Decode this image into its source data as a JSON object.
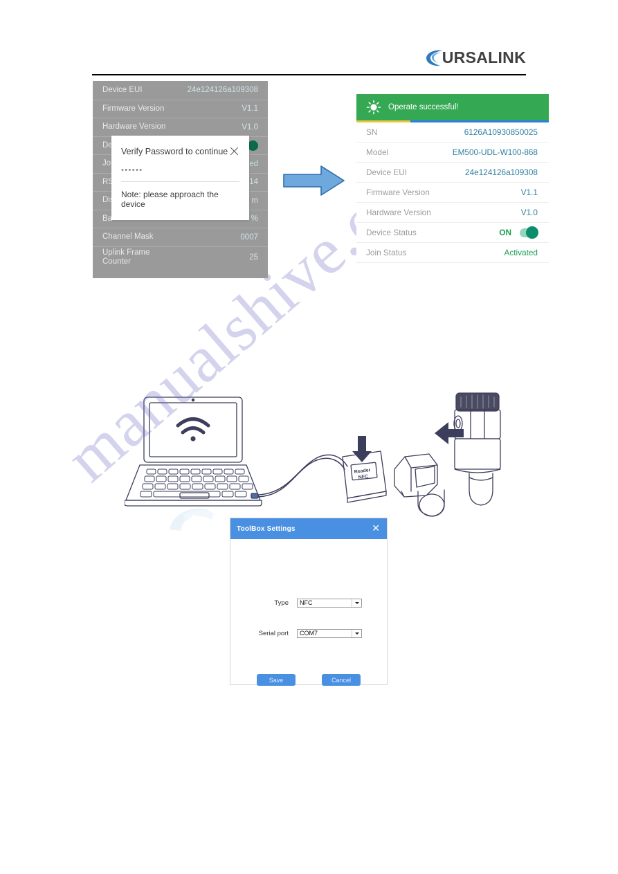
{
  "brand": {
    "name": "URSALINK",
    "mark_icon": "ursalink-swoosh-icon"
  },
  "phone_panel": {
    "rows": [
      {
        "key": "Device EUI",
        "value": "24e124126a109308"
      },
      {
        "key": "Firmware Version",
        "value": "V1.1"
      },
      {
        "key": "Hardware Version",
        "value": "V1.0"
      },
      {
        "key": "De",
        "value": ""
      },
      {
        "key": "Jo",
        "value": "ed"
      },
      {
        "key": "RS",
        "value": "14"
      },
      {
        "key": "Dis",
        "value": " m"
      },
      {
        "key": "Ba",
        "value": " %"
      },
      {
        "key": "Channel Mask",
        "value": "0007"
      },
      {
        "key": "Uplink Frame\nCounter",
        "value": "25"
      }
    ]
  },
  "verify_modal": {
    "title": "Verify Password to continue",
    "close_icon": "close-icon",
    "password_value": "••••••",
    "note": "Note: please approach the device"
  },
  "flow_arrow": {
    "icon": "right-arrow-icon",
    "color": "#6fa8dc"
  },
  "info_panel": {
    "success_banner": {
      "icon": "sun-burst-icon",
      "text": "Operate successful!",
      "color": "#34a853"
    },
    "progress": {
      "segment1_color": "#e8c840",
      "segment2_color": "#2f7de1"
    },
    "rows": [
      {
        "key": "SN",
        "value": "6126A10930850025",
        "style": "value"
      },
      {
        "key": "Model",
        "value": "EM500-UDL-W100-868",
        "style": "value"
      },
      {
        "key": "Device EUI",
        "value": "24e124126a109308",
        "style": "value"
      },
      {
        "key": "Firmware Version",
        "value": "V1.1",
        "style": "value"
      },
      {
        "key": "Hardware Version",
        "value": "V1.0",
        "style": "value"
      },
      {
        "key": "Device Status",
        "value": "ON",
        "style": "status-toggle"
      },
      {
        "key": "Join Status",
        "value": "Activated",
        "style": "green"
      }
    ]
  },
  "illustration": {
    "laptop_icon": "laptop-icon",
    "wifi_icon": "wifi-icon",
    "reader_label_line1": "Reader",
    "reader_label_line2": "NFC",
    "reader_arrow_icon": "down-arrow-icon",
    "sensor_arrow_icon": "left-arrow-icon"
  },
  "toolbox": {
    "title": "ToolBox Settings",
    "close_icon": "close-icon",
    "fields": [
      {
        "label": "Type",
        "value": "NFC"
      },
      {
        "label": "Serial port",
        "value": "COM7"
      }
    ],
    "save_label": "Save",
    "cancel_label": "Cancel",
    "accent_color": "#4a90e2"
  },
  "watermark": {
    "text": "manualshive.com",
    "color": "#6f6fc4"
  }
}
